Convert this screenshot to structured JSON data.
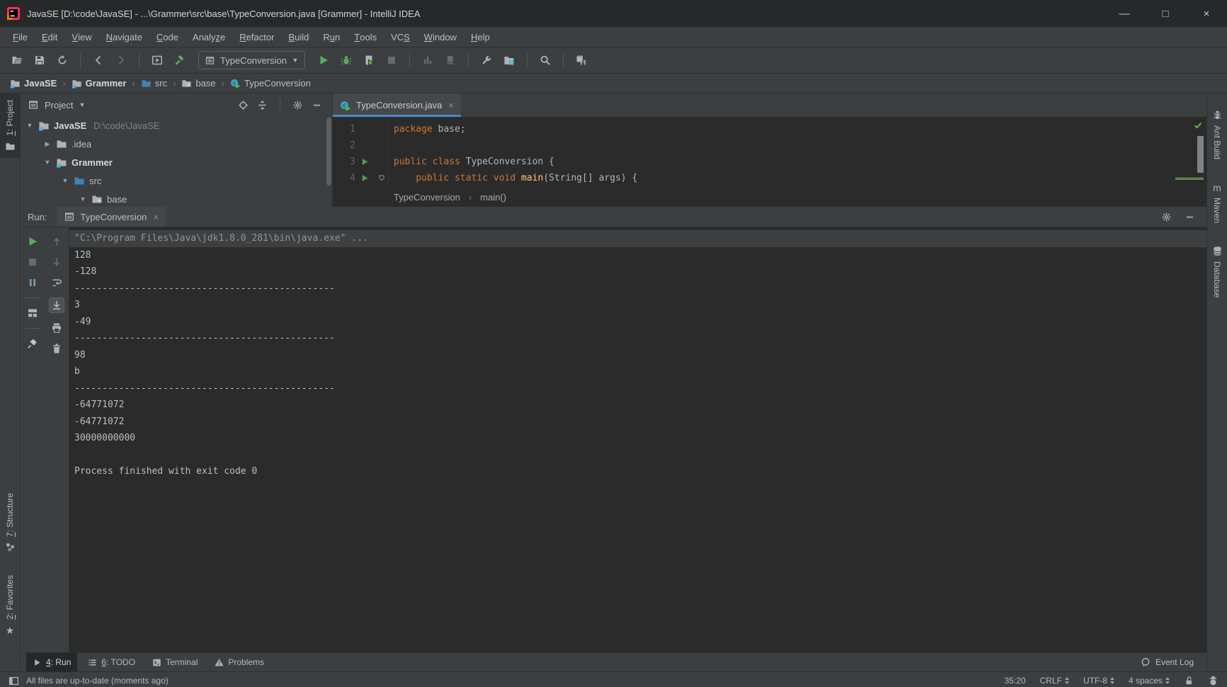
{
  "window": {
    "title": "JavaSE [D:\\code\\JavaSE] - ...\\Grammer\\src\\base\\TypeConversion.java [Grammer] - IntelliJ IDEA",
    "controls": {
      "minimize": "—",
      "maximize": "□",
      "close": "×"
    }
  },
  "menu": {
    "items": [
      {
        "label": "File",
        "u": 0
      },
      {
        "label": "Edit",
        "u": 0
      },
      {
        "label": "View",
        "u": 0
      },
      {
        "label": "Navigate",
        "u": 0
      },
      {
        "label": "Code",
        "u": 0
      },
      {
        "label": "Analyze",
        "u": 5
      },
      {
        "label": "Refactor",
        "u": 0
      },
      {
        "label": "Build",
        "u": 0
      },
      {
        "label": "Run",
        "u": 1
      },
      {
        "label": "Tools",
        "u": 0
      },
      {
        "label": "VCS",
        "u": 2
      },
      {
        "label": "Window",
        "u": 0
      },
      {
        "label": "Help",
        "u": 0
      }
    ]
  },
  "toolbar": {
    "run_config": {
      "label": "TypeConversion"
    },
    "groups": [
      {
        "icons": [
          {
            "name": "open-folder-icon"
          },
          {
            "name": "save-all-icon"
          },
          {
            "name": "sync-icon"
          }
        ]
      },
      {
        "icons": [
          {
            "name": "back-icon"
          },
          {
            "name": "forward-icon",
            "disabled": true
          }
        ]
      },
      {
        "icons": [
          {
            "name": "run-window-icon"
          },
          {
            "name": "build-hammer-icon"
          }
        ]
      },
      {
        "combo": true
      },
      {
        "icons": [
          {
            "name": "run-icon"
          },
          {
            "name": "debug-icon"
          },
          {
            "name": "coverage-icon"
          },
          {
            "name": "stop-icon",
            "disabled": true
          }
        ]
      },
      {
        "icons": [
          {
            "name": "profiler-icon",
            "disabled": true
          },
          {
            "name": "attach-profiler-icon",
            "disabled": true
          }
        ]
      },
      {
        "icons": [
          {
            "name": "settings-wrench-icon"
          },
          {
            "name": "project-structure-icon"
          }
        ]
      },
      {
        "icons": [
          {
            "name": "search-everywhere-icon"
          }
        ]
      },
      {
        "icons": [
          {
            "name": "export-icon"
          }
        ]
      }
    ]
  },
  "navbar": {
    "items": [
      {
        "label": "JavaSE",
        "icon": "module-folder-icon",
        "bold": true
      },
      {
        "label": "Grammer",
        "icon": "module-folder-icon",
        "bold": true
      },
      {
        "label": "src",
        "icon": "src-folder-icon",
        "bold": false
      },
      {
        "label": "base",
        "icon": "package-folder-icon",
        "bold": false
      },
      {
        "label": "TypeConversion",
        "icon": "class-run-icon",
        "bold": false
      }
    ]
  },
  "stripes": {
    "left_top": [
      {
        "label": "1: Project",
        "u": 0,
        "icon": "project-icon",
        "active": true
      }
    ],
    "left_bottom": [
      {
        "label": "7: Structure",
        "u": 0,
        "icon": "structure-icon",
        "active": false
      },
      {
        "label": "2: Favorites",
        "u": 0,
        "icon": "star-icon",
        "active": false
      }
    ],
    "right": [
      {
        "label": "Ant Build",
        "icon": "ant-icon"
      },
      {
        "label": "Maven",
        "icon": "maven-icon"
      },
      {
        "label": "Database",
        "icon": "database-icon"
      }
    ]
  },
  "project_panel": {
    "title": "Project",
    "header_icons": [
      "locate-icon",
      "collapse-all-icon",
      "|",
      "settings-gear-icon",
      "hide-icon"
    ],
    "tree": [
      {
        "level": 0,
        "expand": "open",
        "icon": "module-folder-icon",
        "label": "JavaSE",
        "bold": true,
        "detail": "D:\\code\\JavaSE"
      },
      {
        "level": 1,
        "expand": "closed",
        "icon": "folder-icon",
        "label": ".idea",
        "bold": false
      },
      {
        "level": 1,
        "expand": "open",
        "icon": "module-folder-icon",
        "label": "Grammer",
        "bold": true
      },
      {
        "level": 2,
        "expand": "open",
        "icon": "src-folder-icon",
        "label": "src",
        "bold": false
      },
      {
        "level": 3,
        "expand": "open",
        "icon": "package-folder-icon",
        "label": "base",
        "bold": false
      }
    ]
  },
  "editor": {
    "tab_label": "TypeConversion.java",
    "tab_icon": "class-run-icon",
    "code": [
      {
        "num": "1",
        "run": false,
        "fold": false,
        "tokens": [
          {
            "t": "package",
            "c": "kw"
          },
          {
            "t": " base;",
            "c": "pl"
          }
        ]
      },
      {
        "num": "2",
        "run": false,
        "fold": false,
        "tokens": []
      },
      {
        "num": "3",
        "run": true,
        "fold": false,
        "tokens": [
          {
            "t": "public class ",
            "c": "kw"
          },
          {
            "t": "TypeConversion {",
            "c": "pl"
          }
        ]
      },
      {
        "num": "4",
        "run": true,
        "fold": true,
        "tokens": [
          {
            "t": "    ",
            "c": "pl"
          },
          {
            "t": "public static void ",
            "c": "kw"
          },
          {
            "t": "main",
            "c": "fn"
          },
          {
            "t": "(String[] args) {",
            "c": "pl"
          }
        ]
      }
    ],
    "breadcrumb": [
      "TypeConversion",
      "main()"
    ]
  },
  "run_panel": {
    "label": "Run:",
    "tab_label": "TypeConversion",
    "tab_icon": "app-window-icon",
    "left_toolbar_col1": [
      {
        "name": "rerun-icon"
      },
      {
        "name": "stop-icon",
        "disabled": true
      },
      {
        "name": "pause-icon"
      },
      "|",
      {
        "name": "layout-icon"
      },
      "|",
      {
        "name": "pin-icon"
      }
    ],
    "left_toolbar_col2": [
      {
        "name": "up-stack-icon",
        "disabled": true
      },
      {
        "name": "down-stack-icon",
        "disabled": true
      },
      {
        "name": "soft-wrap-icon"
      },
      {
        "name": "scroll-end-icon",
        "selected": true
      },
      {
        "name": "print-icon"
      },
      {
        "name": "clear-icon"
      }
    ],
    "console_lines": [
      "\"C:\\Program Files\\Java\\jdk1.8.0_281\\bin\\java.exe\" ...",
      "128",
      "-128",
      "-----------------------------------------------",
      "3",
      "-49",
      "-----------------------------------------------",
      "98",
      "b",
      "-----------------------------------------------",
      "-64771072",
      "-64771072",
      "30000000000",
      "",
      "Process finished with exit code 0"
    ]
  },
  "bottom_bar": {
    "tabs": [
      {
        "label": "4: Run",
        "u": 0,
        "icon": "run-arrow-icon",
        "active": true
      },
      {
        "label": "6: TODO",
        "u": 0,
        "icon": "todo-list-icon",
        "active": false
      },
      {
        "label": "Terminal",
        "u": null,
        "icon": "terminal-icon",
        "active": false
      },
      {
        "label": "Problems",
        "u": null,
        "icon": "problems-icon",
        "active": false
      }
    ],
    "event_log": "Event Log"
  },
  "status_bar": {
    "message": "All files are up-to-date (moments ago)",
    "position": "35:20",
    "line_ending": "CRLF",
    "encoding": "UTF-8",
    "indent": "4 spaces"
  },
  "colors": {
    "chrome": "#3c3f41",
    "editor_bg": "#2b2b2b",
    "accent_tab_underline": "#4A88C7",
    "run_green": "#5CA85F",
    "keyword_orange": "#CC7832",
    "method_yellow": "#FFC66D"
  }
}
